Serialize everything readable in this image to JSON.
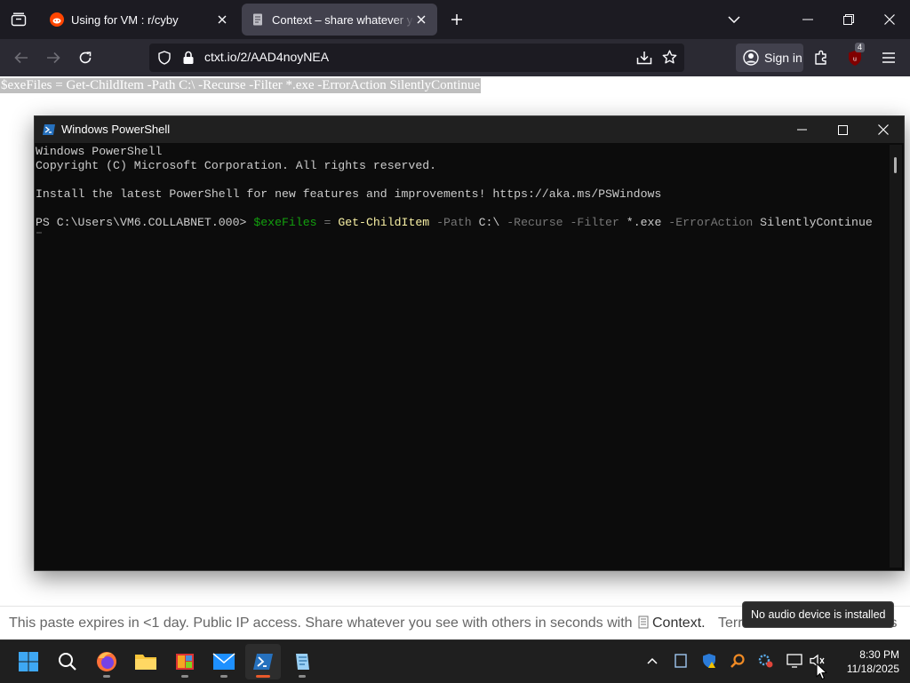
{
  "browser": {
    "tabs": [
      {
        "title": "Using for VM : r/cyby",
        "active": false
      },
      {
        "title": "Context – share whatever you s",
        "active": true
      }
    ],
    "url": "ctxt.io/2/AAD4noyNEA",
    "sign_in_label": "Sign in",
    "extension_badge": "4"
  },
  "page": {
    "selected_text": "$exeFiles = Get-ChildItem -Path C:\\ -Recurse -Filter *.exe -ErrorAction SilentlyContinue",
    "footer": {
      "text": "This paste expires in <1 day. Public IP access. Share whatever you see with others in seconds with",
      "context_label": "Context",
      "terms_label": "Terr",
      "tail": "is"
    }
  },
  "powershell": {
    "title": "Windows PowerShell",
    "lines": [
      "Windows PowerShell",
      "Copyright (C) Microsoft Corporation. All rights reserved.",
      "",
      "Install the latest PowerShell for new features and improvements! https://aka.ms/PSWindows",
      ""
    ],
    "prompt": {
      "path": "PS C:\\Users\\VM6.COLLABNET.000> ",
      "var": "$exeFiles",
      "eq": " = ",
      "cmd": "Get-ChildItem",
      "p1": " -Path",
      "v1": " C:\\",
      "p2": " -Recurse",
      "p3": " -Filter",
      "v3": " *.exe",
      "p4": " -ErrorAction",
      "v4": " SilentlyContinue"
    }
  },
  "tooltip": "No audio device is installed",
  "taskbar": {
    "apps": [
      "start-icon",
      "search-icon",
      "firefox-icon",
      "file-explorer-icon",
      "app-icon",
      "mail-icon",
      "powershell-icon",
      "notepad-icon"
    ],
    "clock_time": "8:30 PM",
    "clock_date": "11/18/2025"
  },
  "colors": {
    "console_bg": "#0c0c0c",
    "ps_variable": "#13a10e",
    "ps_command": "#f9f1a5",
    "ps_parameter": "#767676",
    "browser_dark": "#1c1b22"
  }
}
